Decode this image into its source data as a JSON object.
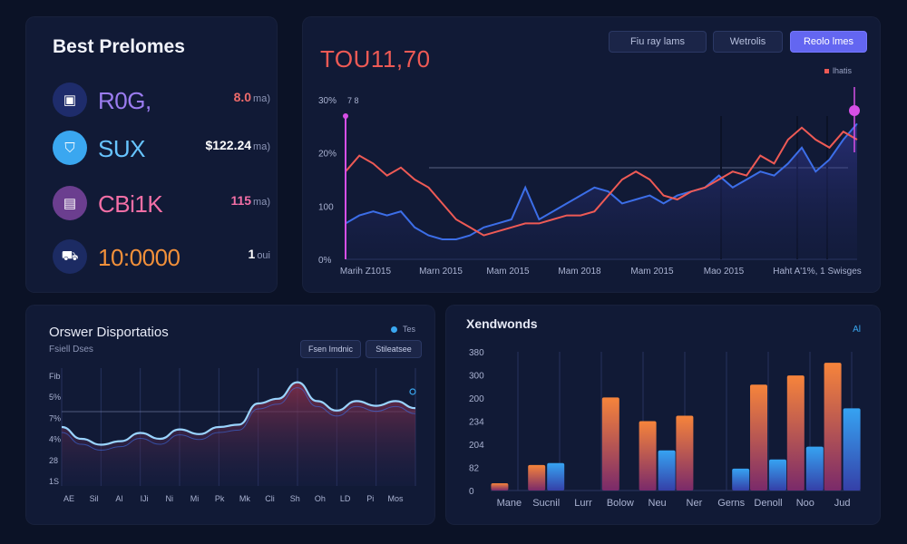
{
  "best_panel": {
    "title": "Best Prelomes",
    "items": [
      {
        "name": "R0G,",
        "value": "8.0",
        "unit": "ma)",
        "icon": "bank-icon",
        "icon_bg": "#1e2c6b",
        "icon_glyph": "▣",
        "name_color": "#9b7cf0",
        "value_color": "#ef6b6b"
      },
      {
        "name": "SUX",
        "value": "$122.24",
        "unit": "ma)",
        "icon": "shield-icon",
        "icon_bg": "#3aa7f0",
        "icon_glyph": "⛉",
        "name_color": "#67c4ff",
        "value_color": "#ffffff"
      },
      {
        "name": "CBi1K",
        "value": "115",
        "unit": "ma)",
        "icon": "card-icon",
        "icon_bg": "#6b3e8f",
        "icon_glyph": "▤",
        "name_color": "#f36fa6",
        "value_color": "#f36fa6"
      },
      {
        "name": "10:0000",
        "value": "1",
        "unit": "oui",
        "icon": "cart-icon",
        "icon_bg": "#1c2b63",
        "icon_glyph": "⛟",
        "name_color": "#f2903a",
        "value_color": "#ffffff"
      }
    ]
  },
  "main_panel": {
    "value": "TOU11,70",
    "buttons": [
      "Fiu ray lams",
      "Wetrolis",
      "Reolo lmes"
    ],
    "legend": "lhatis",
    "colors": {
      "red": "#ee5a55",
      "blue": "#3c6ee8",
      "marker": "#d64fe6"
    }
  },
  "dispositions_panel": {
    "title": "Orswer Disportatios",
    "subtitle": "Fsiell Dses",
    "legend": "Tes",
    "buttons": [
      "Fsen Imdnic",
      "Stileatsee"
    ],
    "colors": {
      "line": "#9ad4ff",
      "fill": "#7a2d4a"
    }
  },
  "bar_panel": {
    "title": "Xendwonds",
    "legend": "Al",
    "colors": {
      "orange": "#f27a3a",
      "blue": "#2f93e8"
    }
  },
  "chart_data": [
    {
      "type": "line",
      "title": "",
      "y_ticks": [
        "30%",
        "20%",
        "100",
        "0%"
      ],
      "y_tick_extra": "7 8",
      "x_ticks": [
        "Marih Z1015",
        "Marn 2015",
        "Mam 2015",
        "Mam 2018",
        "Mam 2015",
        "Mao 2015",
        "Haht A'1%, 1 Swisges"
      ],
      "ylim": [
        0,
        40
      ],
      "series": [
        {
          "values": [
            22,
            26,
            24,
            21,
            23,
            20,
            18,
            14,
            10,
            8,
            6,
            7,
            8,
            9,
            9,
            10,
            11,
            11,
            12,
            16,
            20,
            22,
            20,
            16,
            15,
            17,
            18,
            20,
            22,
            21,
            26,
            24,
            30,
            33,
            30,
            28,
            32,
            30
          ]
        },
        {
          "values": [
            9,
            11,
            12,
            11,
            12,
            8,
            6,
            5,
            5,
            6,
            8,
            9,
            10,
            18,
            10,
            12,
            14,
            16,
            18,
            17,
            14,
            15,
            16,
            14,
            16,
            17,
            18,
            21,
            18,
            20,
            22,
            21,
            24,
            28,
            22,
            25,
            30,
            34
          ]
        }
      ]
    },
    {
      "type": "area",
      "title": "",
      "y_ticks": [
        "Fib",
        "5%",
        "7%",
        "4%",
        "28",
        "1S"
      ],
      "x_ticks": [
        "AE",
        "Sil",
        "Al",
        "IJi",
        "Ni",
        "Mi",
        "Pk",
        "Mk",
        "Cli",
        "Sh",
        "Oh",
        "LD",
        "Pi",
        "Mos"
      ],
      "ylim": [
        0,
        100
      ],
      "series": [
        {
          "values": [
            50,
            40,
            35,
            38,
            45,
            40,
            48,
            44,
            50,
            52,
            70,
            74,
            88,
            72,
            64,
            72,
            68,
            72,
            66
          ]
        }
      ]
    },
    {
      "type": "bar",
      "title": "",
      "categories": [
        "Mane",
        "Sucnil",
        "Lurr",
        "Bolow",
        "Neu",
        "Ner",
        "Gerns",
        "Denoll",
        "Noo",
        "Jud"
      ],
      "y_ticks": [
        "380",
        "300",
        "200",
        "234",
        "204",
        "82",
        "0"
      ],
      "ylim": [
        0,
        380
      ],
      "series": [
        {
          "values": [
            20,
            70,
            0,
            255,
            190,
            205,
            0,
            290,
            315,
            350
          ]
        },
        {
          "values": [
            0,
            75,
            0,
            0,
            110,
            0,
            60,
            85,
            120,
            225
          ]
        }
      ]
    }
  ]
}
